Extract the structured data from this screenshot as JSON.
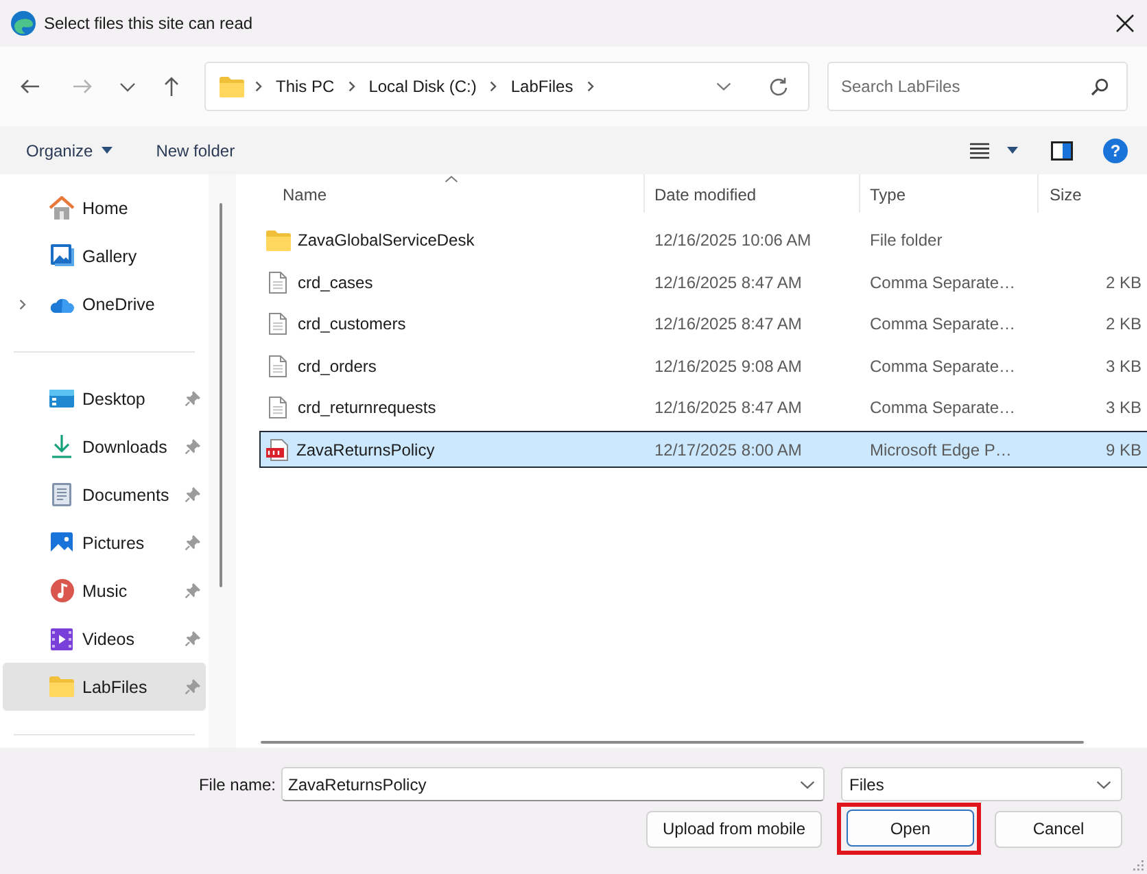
{
  "window": {
    "title": "Select files this site can read"
  },
  "nav_buttons": [
    {
      "kind": "back",
      "disabled": false
    },
    {
      "kind": "forward",
      "disabled": true
    },
    {
      "kind": "recent",
      "disabled": false
    },
    {
      "kind": "up",
      "disabled": false
    }
  ],
  "address": {
    "breadcrumb": [
      "This PC",
      "Local Disk (C:)",
      "LabFiles"
    ]
  },
  "search": {
    "placeholder": "Search LabFiles"
  },
  "toolbar": {
    "buttons": [
      {
        "label": "Organize",
        "dropdown": true
      },
      {
        "label": "New folder",
        "dropdown": false
      }
    ],
    "help": "?"
  },
  "sidebar": {
    "groups": [
      {
        "items": [
          {
            "label": "Home",
            "expandable": false,
            "pinned": false,
            "selected": false
          },
          {
            "label": "Gallery",
            "expandable": false,
            "pinned": false,
            "selected": false
          },
          {
            "label": "OneDrive",
            "expandable": true,
            "pinned": false,
            "selected": false
          }
        ]
      },
      {
        "items": [
          {
            "label": "Desktop",
            "expandable": false,
            "pinned": true,
            "selected": false
          },
          {
            "label": "Downloads",
            "expandable": false,
            "pinned": true,
            "selected": false
          },
          {
            "label": "Documents",
            "expandable": false,
            "pinned": true,
            "selected": false
          },
          {
            "label": "Pictures",
            "expandable": false,
            "pinned": true,
            "selected": false
          },
          {
            "label": "Music",
            "expandable": false,
            "pinned": true,
            "selected": false
          },
          {
            "label": "Videos",
            "expandable": false,
            "pinned": true,
            "selected": false
          },
          {
            "label": "LabFiles",
            "expandable": false,
            "pinned": true,
            "selected": true
          }
        ]
      }
    ]
  },
  "files": {
    "columns": [
      {
        "label": "Name",
        "sorted": true
      },
      {
        "label": "Date modified",
        "sorted": false
      },
      {
        "label": "Type",
        "sorted": false
      },
      {
        "label": "Size",
        "sorted": false
      }
    ],
    "rows": [
      {
        "kind": "folder",
        "name": "ZavaGlobalServiceDesk",
        "date": "12/16/2025 10:06 AM",
        "type": "File folder",
        "selected": false
      },
      {
        "kind": "file",
        "name": "crd_cases",
        "date": "12/16/2025 8:47 AM",
        "type": "Comma Separate…",
        "size": "2 KB",
        "selected": false
      },
      {
        "kind": "file",
        "name": "crd_customers",
        "date": "12/16/2025 8:47 AM",
        "type": "Comma Separate…",
        "size": "2 KB",
        "selected": false
      },
      {
        "kind": "file",
        "name": "crd_orders",
        "date": "12/16/2025 9:08 AM",
        "type": "Comma Separate…",
        "size": "3 KB",
        "selected": false
      },
      {
        "kind": "file",
        "name": "crd_returnrequests",
        "date": "12/16/2025 8:47 AM",
        "type": "Comma Separate…",
        "size": "3 KB",
        "selected": false
      },
      {
        "kind": "pdf",
        "name": "ZavaReturnsPolicy",
        "date": "12/17/2025 8:00 AM",
        "type": "Microsoft Edge P…",
        "size": "9 KB",
        "selected": true
      }
    ]
  },
  "footer": {
    "file_name": {
      "label": "File name:",
      "value": "ZavaReturnsPolicy"
    },
    "filter": {
      "value": "Files"
    },
    "buttons": [
      {
        "label": "Upload from mobile",
        "default": false,
        "highlighted": false
      },
      {
        "label": "Open",
        "default": true,
        "highlighted": true
      },
      {
        "label": "Cancel",
        "default": false,
        "highlighted": false
      }
    ]
  }
}
